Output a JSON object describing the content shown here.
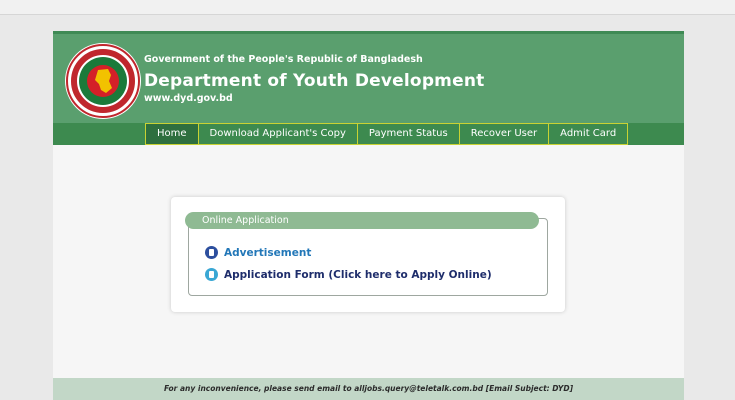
{
  "header": {
    "government": "Government of the People's Republic of Bangladesh",
    "department": "Department of Youth Development",
    "website": "www.dyd.gov.bd"
  },
  "nav": {
    "items": [
      {
        "label": "Home"
      },
      {
        "label": "Download Applicant's Copy"
      },
      {
        "label": "Payment Status"
      },
      {
        "label": "Recover User"
      },
      {
        "label": "Admit Card"
      }
    ]
  },
  "panel": {
    "title": "Online Application",
    "advertisement_link": "Advertisement",
    "application_link": "Application Form (Click here to Apply Online)"
  },
  "footer": {
    "text": "For any inconvenience, please send email to alljobs.query@teletalk.com.bd [Email Subject: DYD]"
  },
  "colors": {
    "header_green": "#5a9f6e",
    "nav_green": "#3d8a4f",
    "nav_border": "#c9d233",
    "link_blue": "#2277b8",
    "link_navy": "#1e2d6b"
  },
  "icons": {
    "logo": "bangladesh-government-seal",
    "advertisement": "document-icon",
    "application": "form-icon"
  }
}
